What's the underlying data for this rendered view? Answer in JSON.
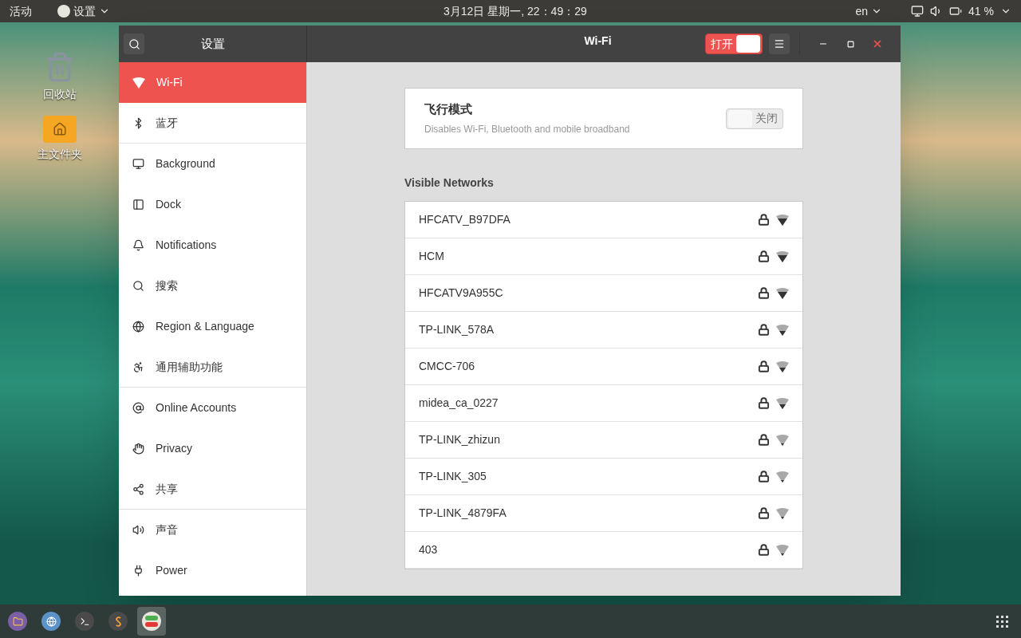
{
  "top_bar": {
    "activities": "活动",
    "app_menu": "设置",
    "clock": "3月12日 星期一, 22：49：29",
    "input_method": "en",
    "battery": "41 %"
  },
  "desktop_icons": [
    {
      "kind": "trash",
      "label": "回收站"
    },
    {
      "kind": "home",
      "label": "主文件夹"
    }
  ],
  "window": {
    "sidebar_title": "设置",
    "title": "Wi-Fi",
    "wifi_switch": {
      "label": "打开",
      "on": true
    }
  },
  "sidebar": {
    "items": [
      {
        "kind": "wifi",
        "label": "Wi-Fi",
        "selected": true,
        "divider": false
      },
      {
        "kind": "bluetooth",
        "label": "蓝牙",
        "selected": false,
        "divider": true
      },
      {
        "kind": "background",
        "label": "Background",
        "selected": false,
        "divider": false
      },
      {
        "kind": "dock",
        "label": "Dock",
        "selected": false,
        "divider": false
      },
      {
        "kind": "bell",
        "label": "Notifications",
        "selected": false,
        "divider": false
      },
      {
        "kind": "search",
        "label": "搜索",
        "selected": false,
        "divider": false
      },
      {
        "kind": "region",
        "label": "Region & Language",
        "selected": false,
        "divider": false
      },
      {
        "kind": "access",
        "label": "通用辅助功能",
        "selected": false,
        "divider": true
      },
      {
        "kind": "accounts",
        "label": "Online Accounts",
        "selected": false,
        "divider": false
      },
      {
        "kind": "privacy",
        "label": "Privacy",
        "selected": false,
        "divider": false
      },
      {
        "kind": "share",
        "label": "共享",
        "selected": false,
        "divider": true
      },
      {
        "kind": "sound",
        "label": "声音",
        "selected": false,
        "divider": false
      },
      {
        "kind": "power",
        "label": "Power",
        "selected": false,
        "divider": false
      }
    ]
  },
  "airplane_mode": {
    "title": "飞行模式",
    "description": "Disables Wi-Fi, Bluetooth and mobile broadband",
    "switch": {
      "label": "关闭",
      "on": false
    }
  },
  "visible_networks": {
    "heading": "Visible Networks",
    "rows": [
      {
        "name": "HFCATV_B97DFA",
        "kind": "strong"
      },
      {
        "name": "HCM",
        "kind": "strong"
      },
      {
        "name": "HFCATV9A955C",
        "kind": "strong"
      },
      {
        "name": "TP-LINK_578A",
        "kind": "medium"
      },
      {
        "name": "CMCC-706",
        "kind": "medium"
      },
      {
        "name": "midea_ca_0227",
        "kind": "medium"
      },
      {
        "name": "TP-LINK_zhizun",
        "kind": "weak"
      },
      {
        "name": "TP-LINK_305",
        "kind": "weak"
      },
      {
        "name": "TP-LINK_4879FA",
        "kind": "weak"
      },
      {
        "name": "403",
        "kind": "weak"
      }
    ]
  },
  "dock": [
    {
      "kind": "files",
      "selected": false
    },
    {
      "kind": "browser",
      "selected": false
    },
    {
      "kind": "terminal",
      "selected": false
    },
    {
      "kind": "editor",
      "selected": false
    },
    {
      "kind": "settings",
      "selected": true
    }
  ]
}
